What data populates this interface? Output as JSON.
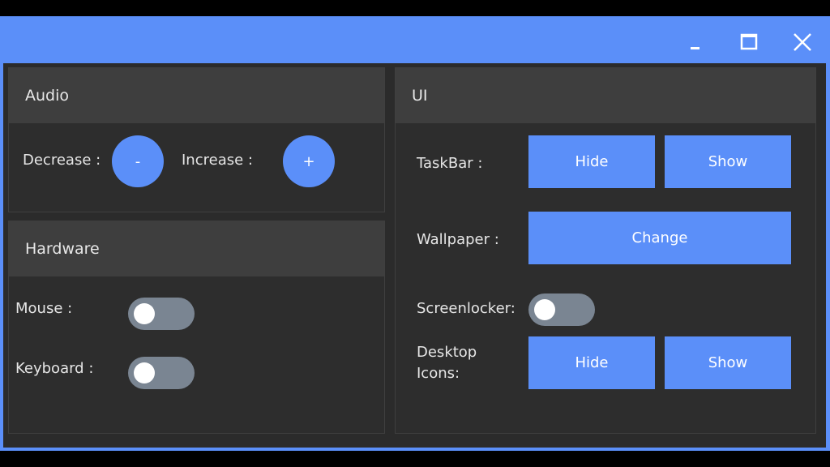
{
  "window": {
    "controls": {
      "minimize": "minimize-icon",
      "maximize": "maximize-icon",
      "close": "close-icon"
    },
    "accent_color": "#5b8ff9",
    "background_color": "#2b2b2b"
  },
  "audio": {
    "title": "Audio",
    "decrease_label": "Decrease :",
    "decrease_button": "-",
    "increase_label": "Increase :",
    "increase_button": "+"
  },
  "hardware": {
    "title": "Hardware",
    "mouse_label": "Mouse :",
    "mouse_on": false,
    "keyboard_label": "Keyboard :",
    "keyboard_on": false
  },
  "ui": {
    "title": "UI",
    "taskbar_label": "TaskBar :",
    "taskbar_hide": "Hide",
    "taskbar_show": "Show",
    "wallpaper_label": "Wallpaper :",
    "wallpaper_change": "Change",
    "screenlocker_label": "Screenlocker:",
    "screenlocker_on": false,
    "desktop_icons_label": "Desktop Icons:",
    "desktop_icons_hide": "Hide",
    "desktop_icons_show": "Show"
  }
}
